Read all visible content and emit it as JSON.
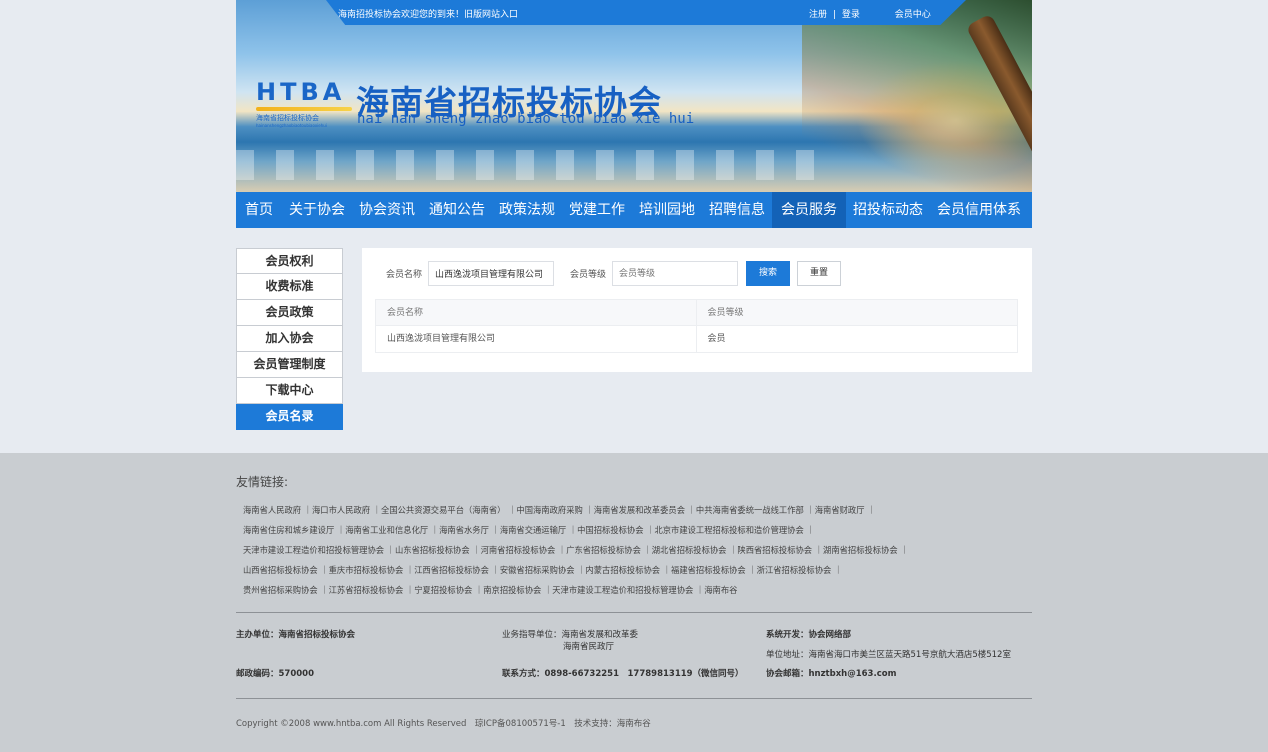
{
  "header": {
    "welcome": "海南招投标协会欢迎您的到来！旧版网站入口",
    "register": "注册",
    "login": "登录",
    "member_center": "会员中心",
    "divider": "|",
    "logo_letters": "HTBA",
    "logo_sub": "海南省招标投标协会",
    "logo_sub2": "hainanshengzhaobiaotoubiaoxiehui",
    "title": "海南省招标投标协会",
    "pinyin": "hai nan sheng zhao biao tou biao xie hui"
  },
  "nav": {
    "items": [
      "首页",
      "关于协会",
      "协会资讯",
      "通知公告",
      "政策法规",
      "党建工作",
      "培训园地",
      "招聘信息",
      "会员服务",
      "招投标动态",
      "会员信用体系"
    ],
    "active_index": 8
  },
  "side": {
    "items": [
      "会员权利",
      "收费标准",
      "会员政策",
      "加入协会",
      "会员管理制度",
      "下载中心",
      "会员名录"
    ],
    "active_index": 6
  },
  "search": {
    "name_label": "会员名称",
    "name_value": "山西逸泷项目管理有限公司",
    "level_label": "会员等级",
    "level_placeholder": "会员等级",
    "search_button": "搜索",
    "reset_button": "重置"
  },
  "table": {
    "headers": [
      "会员名称",
      "会员等级"
    ],
    "rows": [
      [
        "山西逸泷项目管理有限公司",
        "会员"
      ]
    ]
  },
  "footer": {
    "links_title": "友情链接:",
    "links": [
      "海南省人民政府 ｜海口市人民政府 ｜全国公共资源交易平台（海南省） ｜中国海南政府采购 ｜海南省发展和改革委员会 ｜中共海南省委统一战线工作部 ｜海南省财政厅 ｜",
      "海南省住房和城乡建设厅 ｜海南省工业和信息化厅 ｜海南省水务厅 ｜海南省交通运输厅 ｜中国招标投标协会 ｜北京市建设工程招标投标和造价管理协会 ｜",
      "天津市建设工程造价和招投标管理协会 ｜山东省招标投标协会 ｜河南省招标投标协会 ｜广东省招标投标协会 ｜湖北省招标投标协会 ｜陕西省招标投标协会 ｜湖南省招标投标协会 ｜",
      "山西省招标投标协会 ｜重庆市招标投标协会 ｜江西省招标投标协会 ｜安徽省招标采购协会 ｜内蒙古招标投标协会 ｜福建省招标投标协会 ｜浙江省招标投标协会 ｜",
      "贵州省招标采购协会 ｜江苏省招标投标协会 ｜宁夏招投标协会 ｜南京招投标协会 ｜天津市建设工程造价和招投标管理协会 ｜海南布谷"
    ],
    "host": "主办单位：海南省招标投标协会",
    "guide1": "业务指导单位：海南省发展和改革委",
    "guide2": "海南省民政厅",
    "dev": "系统开发：协会网络部",
    "address": "单位地址：海南省海口市美兰区蓝天路51号京航大酒店5楼512室",
    "postcode": "邮政编码：570000",
    "contact": "联系方式：0898-66732251　17789813119（微信同号）",
    "email": "协会邮箱：hnztbxh@163.com",
    "copyright": "Copyright ©2008 www.hntba.com All Rights Reserved　琼ICP备08100571号-1　技术支持：海南布谷"
  }
}
